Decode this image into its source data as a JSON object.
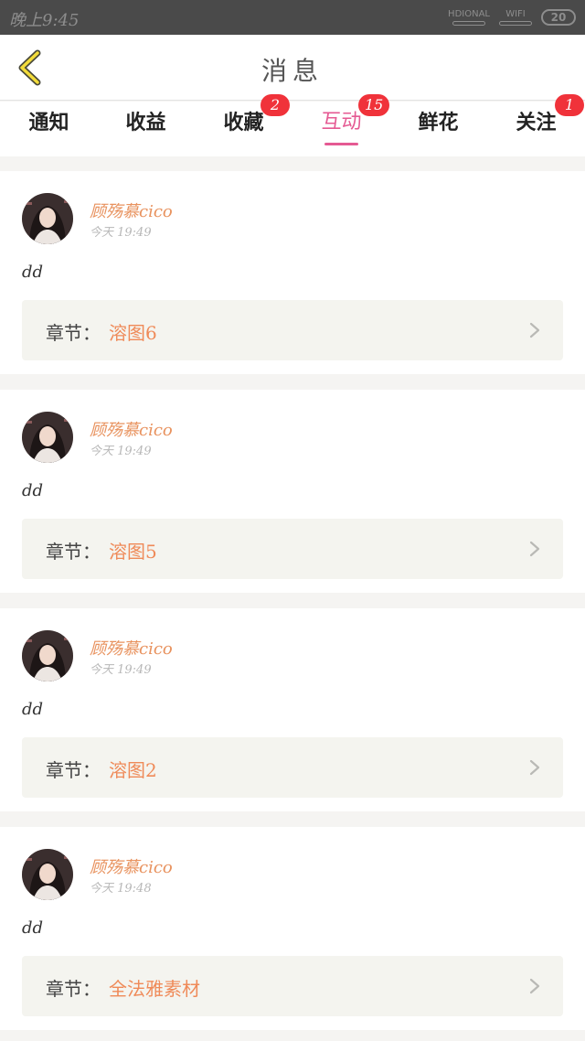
{
  "status_bar": {
    "time": "晚上9:45",
    "signal_label": "HD",
    "signal_sub": "IONAL",
    "wifi_label": "WIFI",
    "battery": "20"
  },
  "nav": {
    "back_icon": "chevron-left-icon",
    "title": "消息"
  },
  "tabs": [
    {
      "label": "通知",
      "badge": null,
      "active": false
    },
    {
      "label": "收益",
      "badge": null,
      "active": false
    },
    {
      "label": "收藏",
      "badge": "2",
      "active": false
    },
    {
      "label": "互动",
      "badge": "15",
      "active": true
    },
    {
      "label": "鲜花",
      "badge": null,
      "active": false
    },
    {
      "label": "关注",
      "badge": "1",
      "active": false
    }
  ],
  "messages": [
    {
      "name": "顾殇慕cico",
      "time": "今天 19:49",
      "text": "dd",
      "chapter_label": "章节：",
      "chapter_value": "溶图6"
    },
    {
      "name": "顾殇慕cico",
      "time": "今天 19:49",
      "text": "dd",
      "chapter_label": "章节：",
      "chapter_value": "溶图5"
    },
    {
      "name": "顾殇慕cico",
      "time": "今天 19:49",
      "text": "dd",
      "chapter_label": "章节：",
      "chapter_value": "溶图2"
    },
    {
      "name": "顾殇慕cico",
      "time": "今天 19:48",
      "text": "dd",
      "chapter_label": "章节：",
      "chapter_value": "全法雅素材"
    }
  ],
  "colors": {
    "accent": "#e55a93",
    "badge": "#f0323a",
    "name": "#e8925e",
    "chapter": "#ef8a58",
    "back_icon": "#f3dc3a"
  }
}
